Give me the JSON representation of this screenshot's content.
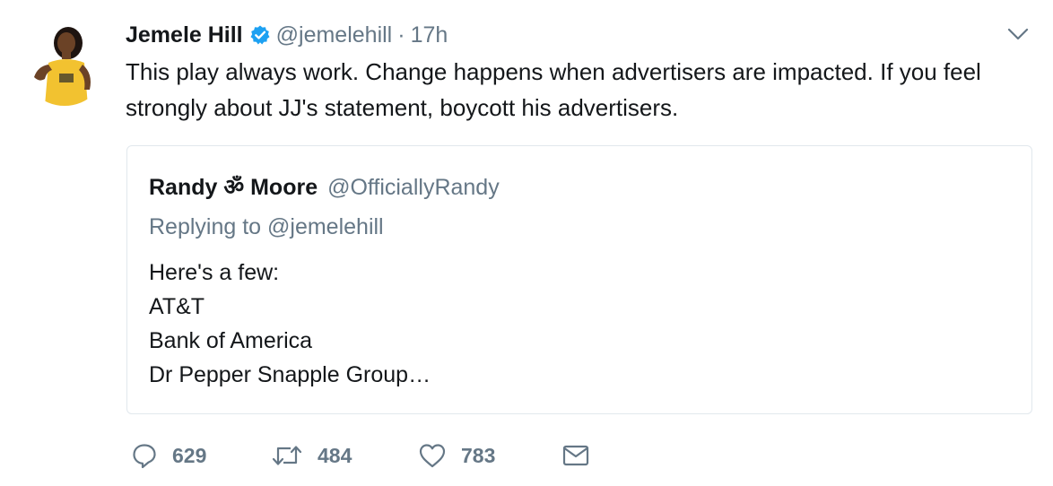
{
  "tweet": {
    "author_name": "Jemele Hill",
    "handle": "@jemelehill",
    "separator": "·",
    "time": "17h",
    "text": "This play always work. Change happens when advertisers are impacted. If you feel strongly about JJ's statement, boycott his advertisers."
  },
  "quoted_tweet": {
    "author_name": "Randy ॐ Moore",
    "handle": "@OfficiallyRandy",
    "replying_to": "Replying to @jemelehill",
    "lines": [
      "Here's a few:",
      "AT&T",
      "Bank of America",
      "Dr Pepper Snapple Group…"
    ]
  },
  "actions": {
    "reply_count": "629",
    "retweet_count": "484",
    "like_count": "783"
  },
  "icons": {
    "verified": "verified-badge-icon",
    "more": "chevron-down-icon",
    "reply": "reply-icon",
    "retweet": "retweet-icon",
    "like": "heart-icon",
    "message": "envelope-icon"
  },
  "colors": {
    "verified_blue": "#1da1f2",
    "muted_gray": "#657786",
    "text_dark": "#14171a",
    "avatar_yellow": "#f2c230",
    "quote_border": "#e1e8ed"
  }
}
